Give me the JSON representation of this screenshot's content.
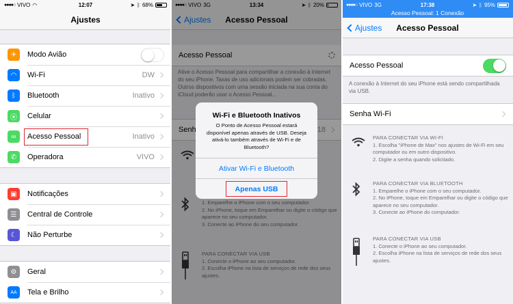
{
  "panel1": {
    "status": {
      "carrier": "VIVO",
      "time": "12:07",
      "battery": "68%",
      "battery_fill": 0.68
    },
    "nav": {
      "title": "Ajustes"
    },
    "groups": [
      {
        "items": [
          {
            "label": "Modo Avião",
            "icon": "airplane-icon",
            "color": "#ff9500",
            "glyph": "✈",
            "toggle": "off"
          },
          {
            "label": "Wi-Fi",
            "icon": "wifi-icon",
            "color": "#007aff",
            "glyph": "◠",
            "value": "DW"
          },
          {
            "label": "Bluetooth",
            "icon": "bluetooth-icon",
            "color": "#007aff",
            "glyph": "ᛒ",
            "value": "Inativo"
          },
          {
            "label": "Celular",
            "icon": "antenna-icon",
            "color": "#4cd964",
            "glyph": "⦿",
            "value": ""
          },
          {
            "label": "Acesso Pessoal",
            "icon": "hotspot-icon",
            "color": "#4cd964",
            "glyph": "∞",
            "value": "Inativo",
            "highlighted": true
          },
          {
            "label": "Operadora",
            "icon": "phone-icon",
            "color": "#4cd964",
            "glyph": "✆",
            "value": "VIVO"
          }
        ]
      },
      {
        "items": [
          {
            "label": "Notificações",
            "icon": "notifications-icon",
            "color": "#ff3b30",
            "glyph": "▣"
          },
          {
            "label": "Central de Controle",
            "icon": "control-center-icon",
            "color": "#8e8e93",
            "glyph": "☰"
          },
          {
            "label": "Não Perturbe",
            "icon": "moon-icon",
            "color": "#5856d6",
            "glyph": "☾"
          }
        ]
      },
      {
        "items": [
          {
            "label": "Geral",
            "icon": "gear-icon",
            "color": "#8e8e93",
            "glyph": "⚙"
          },
          {
            "label": "Tela e Brilho",
            "icon": "brightness-icon",
            "color": "#007aff",
            "glyph": "AA"
          }
        ]
      }
    ]
  },
  "panel2": {
    "status": {
      "carrier": "VIVO",
      "network": "3G",
      "time": "13:34",
      "battery": "20%",
      "battery_fill": 0.2
    },
    "nav": {
      "back": "Ajustes",
      "title": "Acesso Pessoal"
    },
    "hotspot_row": {
      "label": "Acesso Pessoal"
    },
    "footer": "Ative o Acesso Pessoal para compartilhar a conexão à Internet do seu iPhone. Taxas de uso adicionais podem ser cobradas. Outros dispositivos com uma sessão iniciada na sua conta do iCloud poderão usar o Acesso Pessoal...",
    "password_row": {
      "label": "Senh",
      "value": "18"
    },
    "bt_steps": [
      "1. Emparelhe o iPhone com o seu computador.",
      "2. No iPhone, toque em Emparelhar ou digite o código que aparece no seu computador.",
      "3. Conecte ao iPhone do seu computador."
    ],
    "usb_heading": "PARA CONECTAR VIA USB",
    "usb_steps": [
      "1. Conecte o iPhone ao seu computador.",
      "2. Escolha iPhone na lista de serviços de rede dos seus ajustes."
    ],
    "alert": {
      "title": "Wi-Fi e Bluetooth Inativos",
      "message": "O Ponto de Acesso Pessoal estará disponível apenas através de USB. Deseja ativá-lo também através de Wi-Fi e de Bluetooth?",
      "button_primary": "Ativar Wi-Fi e Bluetooth",
      "button_secondary": "Apenas USB"
    }
  },
  "panel3": {
    "status": {
      "carrier": "VIVO",
      "network": "3G",
      "time": "17:38",
      "battery": "95%",
      "battery_fill": 0.95
    },
    "banner": "Acesso Pessoal: 1 Conexão",
    "nav": {
      "back": "Ajustes",
      "title": "Acesso Pessoal"
    },
    "hotspot_row": {
      "label": "Acesso Pessoal",
      "toggle": "on"
    },
    "footer": "A conexão à Internet do seu iPhone está sendo compartilhada via USB.",
    "password_row": {
      "label": "Senha Wi-Fi"
    },
    "wifi_heading": "PARA CONECTAR VIA WI-FI",
    "wifi_steps": [
      "1. Escolha \"iPhone de Max\" nos ajustes de Wi-Fi em seu computador ou em outro dispositivo.",
      "2. Digite a senha quando solicitado."
    ],
    "bt_heading": "PARA CONECTAR VIA BLUETOOTH",
    "bt_steps": [
      "1. Emparelhe o iPhone com o seu computador.",
      "2. No iPhone, toque em Emparelhar ou digite o código que aparece no seu computador.",
      "3. Conecte ao iPhone do computador."
    ],
    "usb_heading": "PARA CONECTAR VIA USB",
    "usb_steps": [
      "1. Conecte o iPhone ao seu computador.",
      "2. Escolha iPhone na lista de serviços de rede dos seus ajustes."
    ]
  },
  "colors": {
    "accent": "#007aff",
    "toggle_on": "#4cd964",
    "highlight": "#e0252e",
    "banner": "#2f8cf5"
  }
}
